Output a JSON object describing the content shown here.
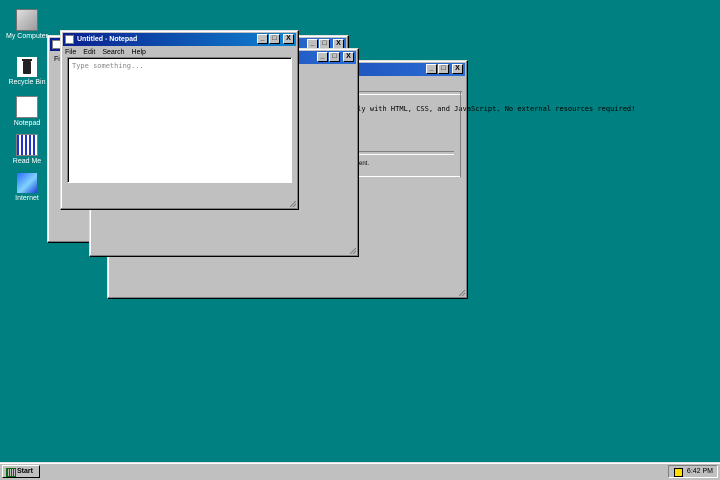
{
  "desktop": {
    "icons": [
      {
        "label": "My Computer"
      },
      {
        "label": "Recycle Bin"
      },
      {
        "label": "Notepad"
      },
      {
        "label": "Read Me"
      },
      {
        "label": "Internet"
      }
    ]
  },
  "windows": {
    "notepad": {
      "title": "Untitled - Notepad",
      "menu": [
        "File",
        "Edit",
        "Search",
        "Help"
      ],
      "placeholder": "Type something..."
    },
    "readme": {
      "body_text": "e, built entirely with HTML, CSS, and JavaScript. No external resources required!",
      "footer_text": "ment."
    },
    "back1": {
      "menu_partial": "Fi"
    },
    "controls": {
      "minimize": "_",
      "maximize": "□",
      "close": "X"
    }
  },
  "taskbar": {
    "start_label": "Start",
    "clock": "6:42 PM"
  }
}
